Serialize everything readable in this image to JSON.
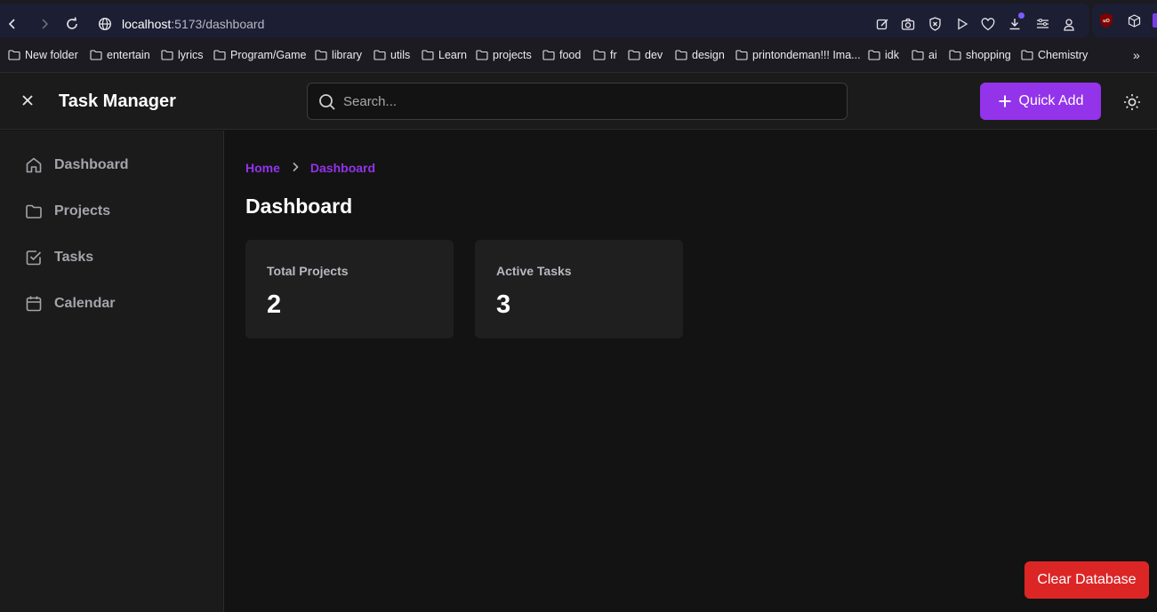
{
  "browser": {
    "url_host": "localhost",
    "url_path": ":5173/dashboard",
    "bookmarks": [
      "New folder",
      "entertain",
      "lyrics",
      "Program/Game",
      "library",
      "utils",
      "Learn",
      "projects",
      "food",
      "fr",
      "dev",
      "design",
      "printondeman!!! Ima...",
      "idk",
      "ai",
      "shopping",
      "Chemistry"
    ],
    "overflow_label": "»"
  },
  "header": {
    "title": "Task Manager",
    "search_placeholder": "Search...",
    "quick_add_label": "Quick Add"
  },
  "sidebar": {
    "items": [
      {
        "label": "Dashboard",
        "icon": "home-icon"
      },
      {
        "label": "Projects",
        "icon": "folder-icon"
      },
      {
        "label": "Tasks",
        "icon": "checkbox-icon"
      },
      {
        "label": "Calendar",
        "icon": "calendar-icon"
      }
    ]
  },
  "main": {
    "breadcrumb": {
      "home": "Home",
      "current": "Dashboard",
      "separator": "›"
    },
    "title": "Dashboard",
    "stats": [
      {
        "label": "Total Projects",
        "value": "2"
      },
      {
        "label": "Active Tasks",
        "value": "3"
      }
    ]
  },
  "footer": {
    "clear_label": "Clear Database"
  },
  "colors": {
    "accent": "#9333ea",
    "danger": "#dc2626",
    "background": "#131313",
    "panel": "#1b1b1b",
    "card": "#1f1f1f"
  }
}
